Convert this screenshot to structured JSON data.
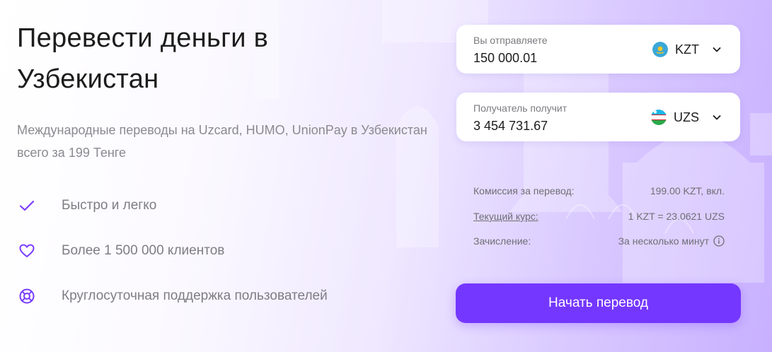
{
  "hero": {
    "title": "Перевести деньги в Узбекистан",
    "subtitle": "Международные переводы на Uzcard, HUMO, UnionPay в Узбекистан всего за 199 Тенге"
  },
  "features": [
    {
      "icon": "check-icon",
      "text": "Быстро и легко"
    },
    {
      "icon": "heart-icon",
      "text": "Более 1 500 000 клиентов"
    },
    {
      "icon": "lifebuoy-icon",
      "text": "Круглосуточная поддержка пользователей"
    }
  ],
  "send": {
    "label": "Вы отправляете",
    "amount": "150 000.01",
    "currency": "KZT",
    "flag_icon": "kazakhstan-flag-icon"
  },
  "receive": {
    "label": "Получатель получит",
    "amount": "3 454 731.67",
    "currency": "UZS",
    "flag_icon": "uzbekistan-flag-icon"
  },
  "details": {
    "commission_label": "Комиссия за перевод:",
    "commission_value": "199.00 KZT, вкл.",
    "rate_label": "Текущий курс:",
    "rate_value": "1 KZT = 23.0621 UZS",
    "crediting_label": "Зачисление:",
    "crediting_value": "За несколько минут"
  },
  "cta": {
    "label": "Начать перевод"
  },
  "colors": {
    "accent": "#7437ff",
    "icon": "#7a3cff",
    "text": "#1c1c1c",
    "muted": "#8a8a8f",
    "bg_gradient_end": "#c8b0ff"
  }
}
